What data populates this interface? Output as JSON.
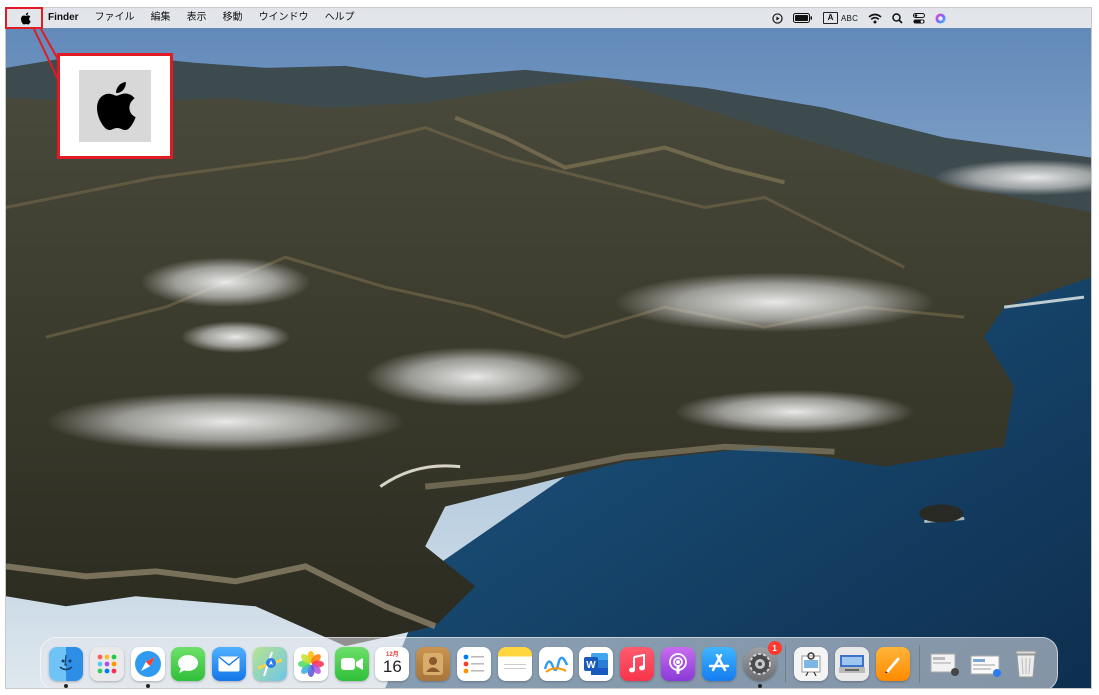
{
  "menubar": {
    "apple_menu": "apple-menu",
    "app_name": "Finder",
    "menus": [
      "ファイル",
      "編集",
      "表示",
      "移動",
      "ウインドウ",
      "ヘルプ"
    ],
    "status_items": [
      "screen-recording-icon",
      "battery-icon",
      "input-source-icon",
      "wifi-icon",
      "spotlight-search-icon",
      "control-center-icon",
      "siri-icon"
    ],
    "input_source_box": "A",
    "input_source_label": "ABC"
  },
  "highlight": {
    "target": "apple-menu",
    "color": "#e01b24",
    "callout": "apple-logo-zoom"
  },
  "dock": {
    "apps": [
      {
        "name": "finder",
        "running": true
      },
      {
        "name": "launchpad"
      },
      {
        "name": "safari",
        "running": true
      },
      {
        "name": "messages"
      },
      {
        "name": "mail"
      },
      {
        "name": "maps"
      },
      {
        "name": "photos"
      },
      {
        "name": "facetime"
      },
      {
        "name": "calendar",
        "month": "12月",
        "day": "16"
      },
      {
        "name": "contacts"
      },
      {
        "name": "reminders"
      },
      {
        "name": "notes"
      },
      {
        "name": "freeform"
      },
      {
        "name": "microsoft-word",
        "letter": "W"
      },
      {
        "name": "music"
      },
      {
        "name": "podcasts"
      },
      {
        "name": "app-store"
      },
      {
        "name": "system-preferences",
        "badge": "1",
        "running": true
      },
      {
        "name": "preview"
      },
      {
        "name": "image-capture"
      },
      {
        "name": "pages"
      },
      {
        "name": "downloads-folder"
      },
      {
        "name": "documents-stack"
      },
      {
        "name": "trash"
      }
    ],
    "separators_after": [
      "system-preferences",
      "pages"
    ]
  }
}
